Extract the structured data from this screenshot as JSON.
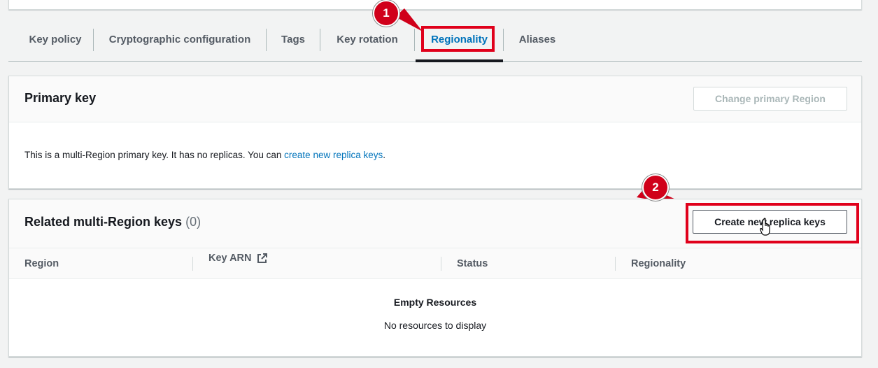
{
  "tabs": [
    {
      "label": "Key policy"
    },
    {
      "label": "Cryptographic configuration"
    },
    {
      "label": "Tags"
    },
    {
      "label": "Key rotation"
    },
    {
      "label": "Regionality",
      "active": true
    },
    {
      "label": "Aliases"
    }
  ],
  "callouts": {
    "first": "1",
    "second": "2"
  },
  "primary_key": {
    "title": "Primary key",
    "change_button": "Change primary Region",
    "description": "This is a multi-Region primary key. It has no replicas. You can ",
    "link_text": "create new replica keys",
    "trailing": "."
  },
  "related": {
    "title": "Related multi-Region keys",
    "count": "(0)",
    "create_button": "Create new replica keys",
    "columns": [
      "Region",
      "Key ARN",
      "Status",
      "Regionality"
    ],
    "empty_title": "Empty Resources",
    "empty_message": "No resources to display"
  },
  "colors": {
    "accent_link": "#0073bb",
    "highlight": "#e0001b"
  },
  "icons": {
    "key_arn": "external-link-icon",
    "cursor": "hand-pointer-icon"
  }
}
